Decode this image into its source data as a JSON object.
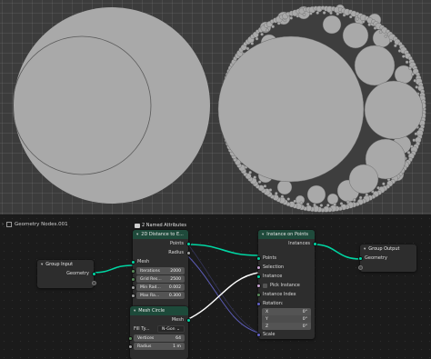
{
  "editor": {
    "tree_name": "Geometry Nodes.001",
    "attributes_badge": "2 Named Attributes"
  },
  "nodes": {
    "group_input": {
      "title": "Group Input",
      "outputs": [
        "Geometry"
      ]
    },
    "distance_node": {
      "title": "2D Distance to E...",
      "outputs": [
        "Points",
        "Radius"
      ],
      "inputs": [
        {
          "label": "Mesh"
        },
        {
          "label": "Iterations",
          "value": "2000"
        },
        {
          "label": "Grid Res...",
          "value": "2500"
        },
        {
          "label": "Min Rad...",
          "value": "0.002"
        },
        {
          "label": "Max Ra...",
          "value": "0.300"
        }
      ]
    },
    "mesh_circle": {
      "title": "Mesh Circle",
      "outputs": [
        "Mesh"
      ],
      "fill_type_label": "Fill Ty...",
      "fill_type_value": "N-Gon",
      "inputs": [
        {
          "label": "Vertices",
          "value": "64"
        },
        {
          "label": "Radius",
          "value": "1 m"
        }
      ]
    },
    "instance_on_points": {
      "title": "Instance on Points",
      "outputs": [
        "Instances"
      ],
      "inputs": {
        "points": "Points",
        "selection": "Selection",
        "instance": "Instance",
        "pick_instance": "Pick Instance",
        "instance_index": "Instance Index",
        "rotation": "Rotation:",
        "rotation_values": [
          {
            "axis": "X",
            "value": "0°"
          },
          {
            "axis": "Y",
            "value": "0°"
          },
          {
            "axis": "Z",
            "value": "0°"
          }
        ],
        "scale": "Scale"
      }
    },
    "group_output": {
      "title": "Group Output",
      "inputs": [
        "Geometry"
      ]
    }
  },
  "colors": {
    "geometry_socket": "#00d6a3",
    "vector_socket": "#6363c7",
    "float_socket": "#a1a1a1",
    "viewport_disc": "#a9a9a9",
    "viewport_background": "#3c3c3c",
    "node_header_geometry": "#1f4a3b"
  },
  "icons": [
    "node-tree-icon",
    "collapse-caret-icon",
    "attribute-icon",
    "checkbox-icon"
  ]
}
